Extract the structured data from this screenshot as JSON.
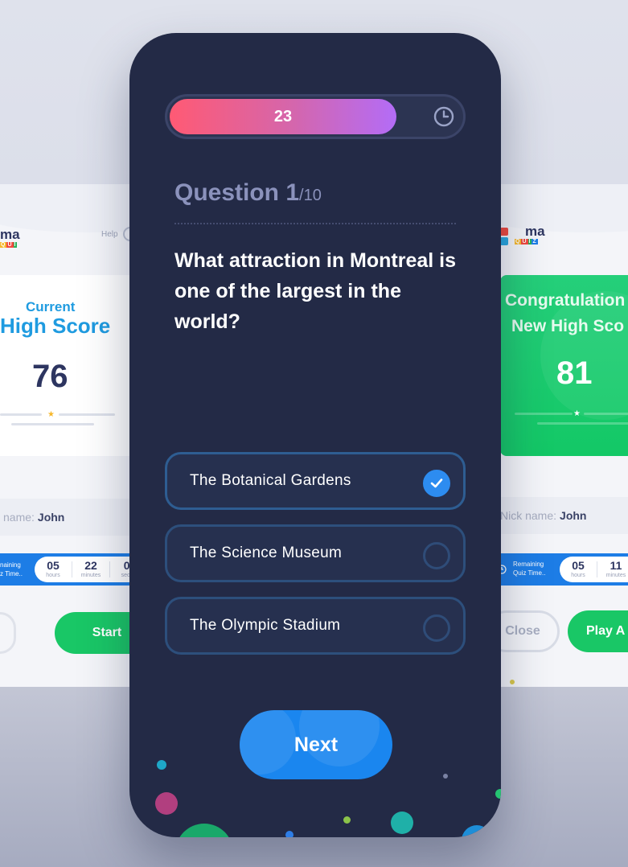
{
  "left_card": {
    "logo_text": "ma",
    "logo_sub": [
      "Q",
      "U",
      "I",
      "Z"
    ],
    "help_label": "Help",
    "score_title_line1": "Current",
    "score_title_line2": "High Score",
    "score_value": "76",
    "nick_label": "name:",
    "nick_value": "John",
    "timer_label": "naining\nz Time..",
    "timer": [
      {
        "value": "05",
        "unit": "hours"
      },
      {
        "value": "22",
        "unit": "minutes"
      },
      {
        "value": "0:",
        "unit": "secon"
      }
    ],
    "start_label": "Start"
  },
  "right_card": {
    "logo_text": "ma",
    "logo_sub": [
      "Q",
      "U",
      "I",
      "Z"
    ],
    "title_line1": "Congratulation",
    "title_line2": "New High Sco",
    "score_value": "81",
    "nick_label": "Nick name:",
    "nick_value": "John",
    "timer_label_line1": "Remaining",
    "timer_label_line2": "Quiz Time..",
    "timer": [
      {
        "value": "05",
        "unit": "hours"
      },
      {
        "value": "11",
        "unit": "minutes"
      }
    ],
    "close_label": "Close",
    "play_label": "Play A"
  },
  "quiz": {
    "timer_value": "23",
    "timer_progress": 0.78,
    "question_word": "Question 1",
    "question_total": "/10",
    "question_text": "What attraction in Montreal is one of the largest in the world?",
    "answers": [
      {
        "label": "The Botanical Gardens",
        "selected": true
      },
      {
        "label": "The Science Museum",
        "selected": false
      },
      {
        "label": "The Olympic Stadium",
        "selected": false
      }
    ],
    "next_label": "Next"
  },
  "colors": {
    "phone_bg": "#232a46",
    "accent_blue": "#1a86ef",
    "progress_start": "#ff5a74",
    "progress_end": "#b36cf7",
    "green": "#13c866",
    "score_blue": "#1f9be0"
  },
  "icons": [
    "clock-icon",
    "check-icon",
    "help-icon",
    "timer-icon"
  ]
}
